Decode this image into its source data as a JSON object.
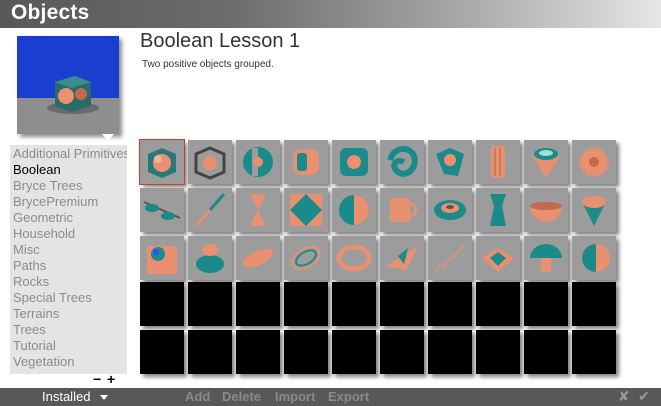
{
  "window": {
    "title": "Objects"
  },
  "lesson": {
    "title": "Boolean Lesson 1",
    "description": "Two positive objects grouped."
  },
  "categories": [
    "Additional Primitives",
    "Boolean",
    "Bryce Trees",
    "BrycePremium",
    "Geometric",
    "Household",
    "Misc",
    "Paths",
    "Rocks",
    "Special Trees",
    "Terrains",
    "Trees",
    "Tutorial",
    "Vegetation"
  ],
  "selected_category": "Boolean",
  "list_controls": {
    "remove_label": "−",
    "add_label": "+"
  },
  "grid": {
    "rows": [
      [
        "boolean-cube-sphere",
        "boolean-cage-cube",
        "boolean-sphere-cutout",
        "boolean-rounded-cube",
        "boolean-holed-cube",
        "boolean-twisted-knot",
        "boolean-carved-shape",
        "boolean-fluted-column",
        "boolean-teal-cup",
        "boolean-gear-disk"
      ],
      [
        "boolean-spectacles",
        "boolean-wand",
        "boolean-hourglass",
        "boolean-diamond-tile",
        "boolean-bent-disk",
        "boolean-mug",
        "boolean-torus-bowl",
        "boolean-vase",
        "boolean-bowl",
        "boolean-cone-plate"
      ],
      [
        "boolean-sphere-frame",
        "boolean-pot",
        "boolean-flat-disk",
        "boolean-rings",
        "boolean-ring",
        "boolean-jet",
        "boolean-coil",
        "boolean-spinner",
        "boolean-mushroom",
        "boolean-split-sphere"
      ],
      [
        "empty",
        "empty",
        "empty",
        "empty",
        "empty",
        "empty",
        "empty",
        "empty",
        "empty",
        "empty"
      ],
      [
        "empty",
        "empty",
        "empty",
        "empty",
        "empty",
        "empty",
        "empty",
        "empty",
        "empty",
        "empty"
      ]
    ],
    "selected_item": "boolean-cube-sphere"
  },
  "bottom_bar": {
    "library_label": "Installed",
    "add_label": "Add",
    "delete_label": "Delete",
    "import_label": "Import",
    "export_label": "Export"
  },
  "icons": {
    "cancel": "cancel-x-icon",
    "confirm": "confirm-check-icon"
  },
  "colors": {
    "teal": "#1a8a8a",
    "salmon": "#e89070",
    "title_bar_start": "#585858",
    "title_bar_end": "#e6e6e6",
    "preview_sky": "#1a3fd0",
    "preview_ground": "#8e8e8e",
    "selection_outline": "#d23a2a"
  }
}
